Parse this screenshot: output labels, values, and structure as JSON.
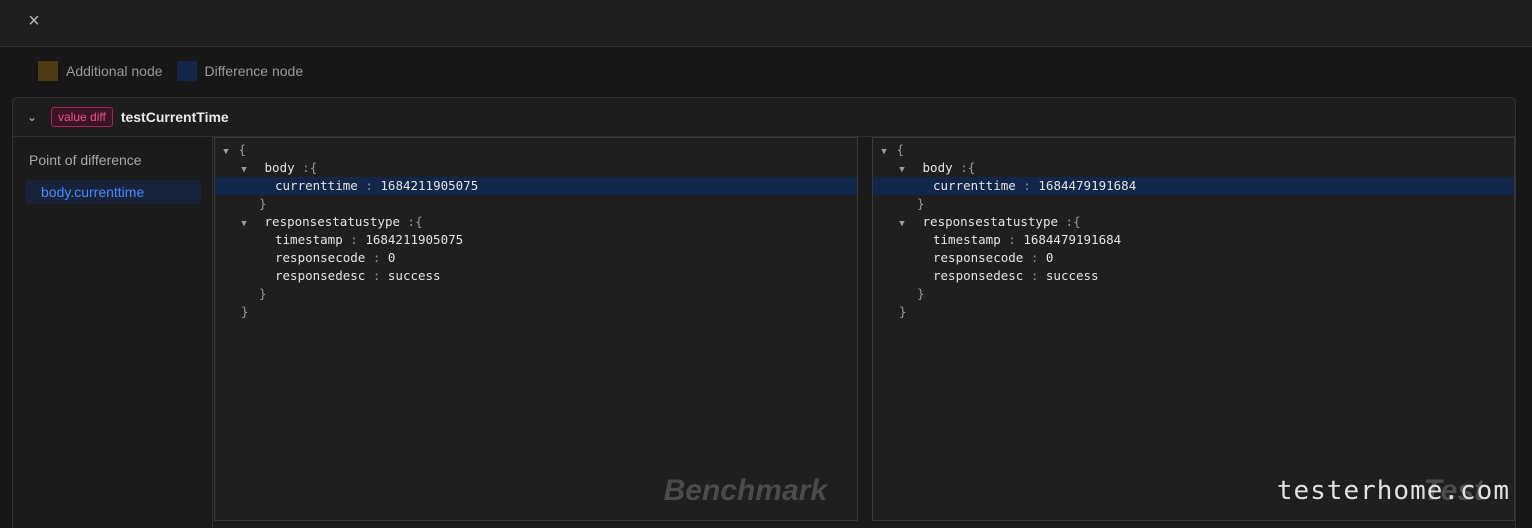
{
  "window": {
    "close_label": "×"
  },
  "legend": {
    "items": [
      {
        "label": "Additional node",
        "color": "#4d3a17"
      },
      {
        "label": "Difference node",
        "color": "#13264a"
      }
    ]
  },
  "case": {
    "badge": "value diff",
    "name": "testCurrentTime"
  },
  "sidebar": {
    "title": "Point of difference",
    "items": [
      {
        "label": "body.currenttime"
      }
    ]
  },
  "benchmark": {
    "watermark": "Benchmark",
    "open": "{",
    "close": "}",
    "body_key": "body",
    "currenttime_key": "currenttime",
    "currenttime_val": "1684211905075",
    "rst_key": "responsestatustype",
    "timestamp_key": "timestamp",
    "timestamp_val": "1684211905075",
    "responsecode_key": "responsecode",
    "responsecode_val": "0",
    "responsedesc_key": "responsedesc",
    "responsedesc_val": "success"
  },
  "test": {
    "watermark": "Test",
    "open": "{",
    "close": "}",
    "body_key": "body",
    "currenttime_key": "currenttime",
    "currenttime_val": "1684479191684",
    "rst_key": "responsestatustype",
    "timestamp_key": "timestamp",
    "timestamp_val": "1684479191684",
    "responsecode_key": "responsecode",
    "responsecode_val": "0",
    "responsedesc_key": "responsedesc",
    "responsedesc_val": "success"
  },
  "site_watermark": "testerhome.com",
  "tokens": {
    "colon": ":",
    "brace_open": "{",
    "brace_close": "}"
  }
}
